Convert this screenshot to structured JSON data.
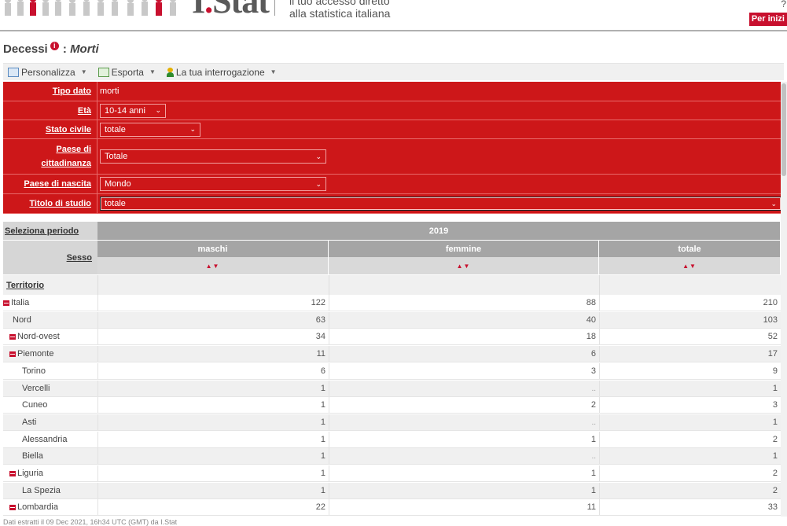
{
  "header": {
    "logo_main": "I",
    "logo_dot": ".",
    "logo_rest": "Stat",
    "tagline_line1": "il tuo accesso diretto",
    "tagline_line2": "alla statistica italiana",
    "right_mark": "?",
    "per_inizi_label": "Per inizi"
  },
  "title": {
    "main": "Decessi",
    "info_badge": "i",
    "separator": " : ",
    "subtitle": "Morti"
  },
  "toolbar": {
    "personalizza": "Personalizza",
    "esporta": "Esporta",
    "interrogazione": "La tua interrogazione",
    "caret": "▼"
  },
  "filters": {
    "tipo_dato_label": "Tipo dato",
    "tipo_dato_value": "morti",
    "eta_label": "Età",
    "eta_value": "10-14 anni",
    "stato_civile_label": "Stato civile",
    "stato_civile_value": "totale",
    "paese_citt_label_1": "Paese di",
    "paese_citt_label_2": "cittadinanza",
    "paese_citt_value": "Totale",
    "paese_nascita_label": "Paese di nascita",
    "paese_nascita_value": "Mondo",
    "titolo_studio_label": "Titolo di studio",
    "titolo_studio_value": "totale",
    "chevron": "⌄"
  },
  "table": {
    "periodo_label": "Seleziona periodo",
    "year": "2019",
    "sesso_label": "Sesso",
    "col_maschi": "maschi",
    "col_femmine": "femmine",
    "col_totale": "totale",
    "sort_arrows": "▲▼",
    "territorio_label": "Territorio",
    "rows": [
      {
        "name": "Italia",
        "indent": 0,
        "toggle": true,
        "maschi": "122",
        "femmine": "88",
        "totale": "210"
      },
      {
        "name": "Nord",
        "indent": 1,
        "toggle": false,
        "maschi": "63",
        "femmine": "40",
        "totale": "103"
      },
      {
        "name": "Nord-ovest",
        "indent": 1,
        "toggle": true,
        "maschi": "34",
        "femmine": "18",
        "totale": "52"
      },
      {
        "name": "Piemonte",
        "indent": 2,
        "toggle": true,
        "maschi": "11",
        "femmine": "6",
        "totale": "17"
      },
      {
        "name": "Torino",
        "indent": 3,
        "toggle": false,
        "maschi": "6",
        "femmine": "3",
        "totale": "9"
      },
      {
        "name": "Vercelli",
        "indent": 3,
        "toggle": false,
        "maschi": "1",
        "femmine": "..",
        "totale": "1"
      },
      {
        "name": "Cuneo",
        "indent": 3,
        "toggle": false,
        "maschi": "1",
        "femmine": "2",
        "totale": "3"
      },
      {
        "name": "Asti",
        "indent": 3,
        "toggle": false,
        "maschi": "1",
        "femmine": "..",
        "totale": "1"
      },
      {
        "name": "Alessandria",
        "indent": 3,
        "toggle": false,
        "maschi": "1",
        "femmine": "1",
        "totale": "2"
      },
      {
        "name": "Biella",
        "indent": 3,
        "toggle": false,
        "maschi": "1",
        "femmine": "..",
        "totale": "1"
      },
      {
        "name": "Liguria",
        "indent": 2,
        "toggle": true,
        "maschi": "1",
        "femmine": "1",
        "totale": "2"
      },
      {
        "name": "La Spezia",
        "indent": 3,
        "toggle": false,
        "maschi": "1",
        "femmine": "1",
        "totale": "2"
      },
      {
        "name": "Lombardia",
        "indent": 2,
        "toggle": true,
        "maschi": "22",
        "femmine": "11",
        "totale": "33"
      }
    ]
  },
  "footer": {
    "note": "Dati estratti il 09 Dec 2021, 16h34 UTC (GMT) da I.Stat"
  },
  "colors": {
    "filter_red": "#cd1719",
    "brand_red": "#c8102e",
    "header_grey": "#a5a5a5"
  },
  "icons": [
    "crowd-banner-icon",
    "info-icon",
    "personalizza-icon",
    "esporta-icon",
    "user-icon",
    "toggle-minus-icon",
    "sort-arrows-icon",
    "chevron-down-icon"
  ]
}
